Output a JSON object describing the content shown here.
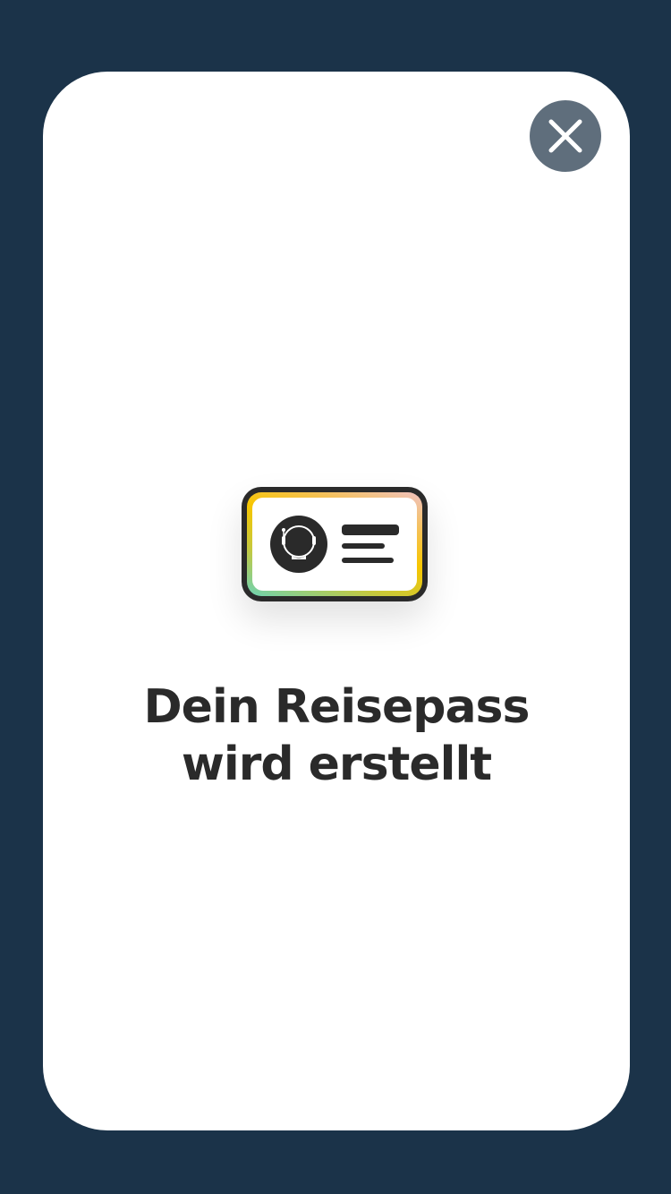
{
  "dialog": {
    "title_line1": "Dein Reisepass",
    "title_line2": "wird erstellt",
    "close_icon": "close-icon",
    "illustration_icon": "passport-icon"
  },
  "colors": {
    "background": "#1b3349",
    "close_button": "#5f6e7c",
    "text": "#2a2a2a"
  }
}
